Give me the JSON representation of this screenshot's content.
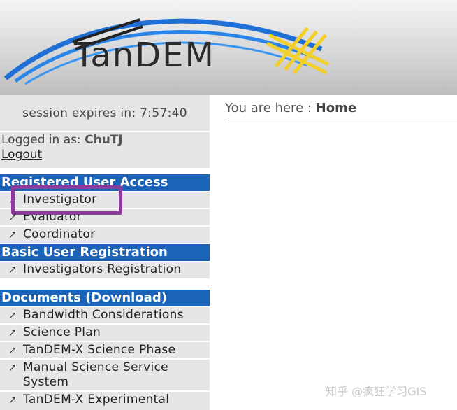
{
  "banner": {
    "logo_text": "TanDEM"
  },
  "session": {
    "text": "session expires in: 7:57:40"
  },
  "login": {
    "prefix": "Logged in as: ",
    "username": "ChuTJ",
    "logout_label": "Logout"
  },
  "sections": [
    {
      "title": "Registered User Access",
      "items": [
        "Investigator",
        "Evaluator",
        "Coordinator"
      ]
    },
    {
      "title": "Basic User Registration",
      "items": [
        "Investigators Registration"
      ]
    },
    {
      "title": "Documents (Download)",
      "items": [
        "Bandwidth Considerations",
        "Science Plan",
        "TanDEM-X Science Phase",
        "Manual Science Service System",
        "TanDEM-X Experimental"
      ]
    }
  ],
  "nav_arrow": "↗",
  "breadcrumb": {
    "prefix": "You are here : ",
    "current": "Home"
  },
  "watermark": "知乎 @疯狂学习GIS",
  "colors": {
    "section_header": "#1a63b8",
    "nav_bg": "#e6e6e6",
    "highlight": "#8e3a9d",
    "logo_blue": "#1f6fd6",
    "logo_yellow": "#f2cf2a"
  }
}
